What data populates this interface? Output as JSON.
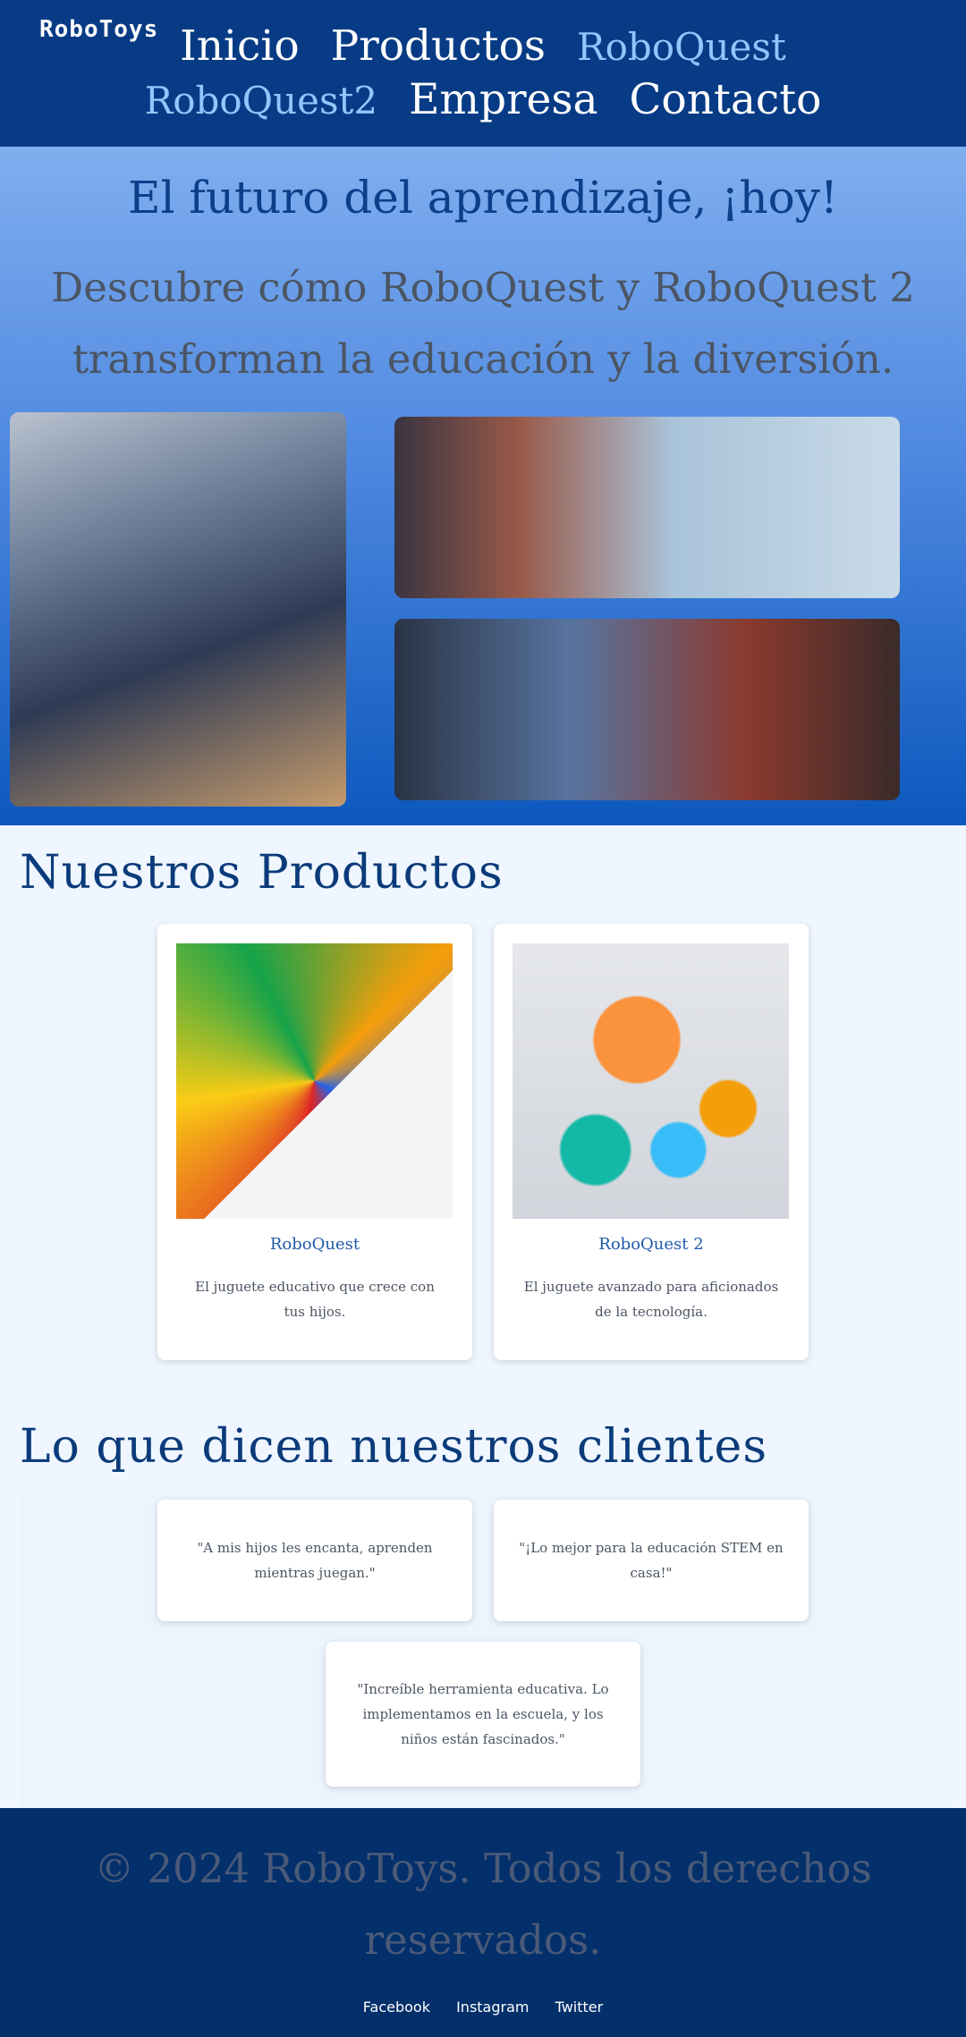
{
  "header": {
    "logo": "RoboToys",
    "nav": {
      "inicio": "Inicio",
      "productos": "Productos",
      "roboquest": "RoboQuest",
      "roboquest2": "RoboQuest2",
      "empresa": "Empresa",
      "contacto": "Contacto"
    }
  },
  "hero": {
    "title": "El futuro del aprendizaje, ¡hoy!",
    "subtitle": "Descubre cómo RoboQuest y RoboQuest 2 transforman la educación y la diversión."
  },
  "products": {
    "title": "Nuestros Productos",
    "items": [
      {
        "name": "RoboQuest",
        "description": "El juguete educativo que crece con tus hijos."
      },
      {
        "name": "RoboQuest 2",
        "description": "El juguete avanzado para aficionados de la tecnología."
      }
    ]
  },
  "testimonials": {
    "title": "Lo que dicen nuestros clientes",
    "items": [
      "\"A mis hijos les encanta, aprenden mientras juegan.\"",
      "\"¡Lo mejor para la educación STEM en casa!\"",
      "\"Increíble herramienta educativa. Lo implementamos en la escuela, y los niños están fascinados.\""
    ]
  },
  "footer": {
    "copyright": "© 2024 RoboToys. Todos los derechos reservados.",
    "links": [
      "Facebook",
      "Instagram",
      "Twitter"
    ]
  },
  "colors": {
    "header_bg": "#073b85",
    "accent_link": "#93c5fd",
    "page_bg": "#eff6ff",
    "footer_bg": "#03306b"
  }
}
